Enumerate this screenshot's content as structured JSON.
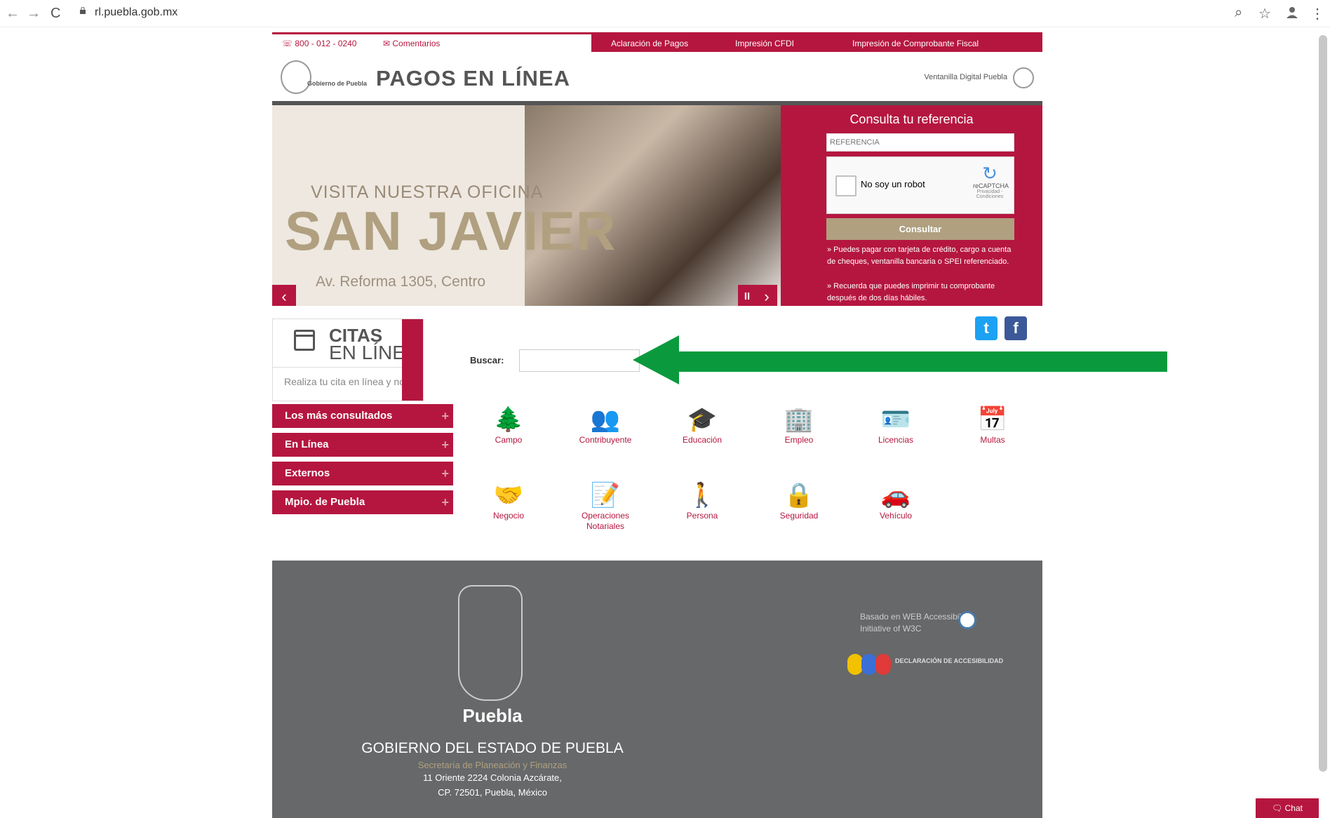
{
  "browser": {
    "url": "rl.puebla.gob.mx",
    "back_icon": "←",
    "forward_icon": "→",
    "reload_icon": "C",
    "zoom_icon": "⌕",
    "star_icon": "☆",
    "menu_icon": "⋮"
  },
  "topbar": {
    "phone": "800 - 012 - 0240",
    "comments": "Comentarios",
    "links": [
      "Aclaración de Pagos",
      "Impresión CFDI",
      "Impresión de Comprobante Fiscal"
    ]
  },
  "brand": {
    "gob_label": "Gobierno de Puebla",
    "title": "PAGOS EN LÍNEA",
    "right_label": "Ventanilla Digital Puebla"
  },
  "hero": {
    "kicker": "VISITA NUESTRA OFICINA",
    "headline": "SAN JAVIER",
    "address": "Av. Reforma 1305, Centro",
    "prev": "‹",
    "pause": "II",
    "next": "›"
  },
  "referencia": {
    "title": "Consulta tu referencia",
    "placeholder": "REFERENCIA",
    "captcha_label": "No soy un robot",
    "captcha_brand": "reCAPTCHA",
    "captcha_terms": "Privacidad - Condiciones",
    "button": "Consultar",
    "note1": "» Puedes pagar con tarjeta de crédito, cargo a cuenta de cheques, ventanilla bancaria o SPEI referenciado.",
    "note2": "» Recuerda que puedes imprimir tu comprobante después de dos días hábiles."
  },
  "citas": {
    "title1": "CITAS",
    "title2": "EN LÍNEA",
    "subtitle": "Realiza tu cita en línea y no hagas filas"
  },
  "menu": [
    {
      "label": "Los más consultados",
      "plus": "+"
    },
    {
      "label": "En Línea",
      "plus": "+"
    },
    {
      "label": "Externos",
      "plus": "+"
    },
    {
      "label": "Mpio. de Puebla",
      "plus": "+"
    }
  ],
  "search": {
    "label": "Buscar:"
  },
  "social": {
    "twitter": "t",
    "facebook": "f"
  },
  "categories": [
    {
      "label": "Campo",
      "icon": "🌲"
    },
    {
      "label": "Contribuyente",
      "icon": "👥"
    },
    {
      "label": "Educación",
      "icon": "🎓"
    },
    {
      "label": "Empleo",
      "icon": "🏢"
    },
    {
      "label": "Licencias",
      "icon": "🪪"
    },
    {
      "label": "Multas",
      "icon": "📅"
    },
    {
      "label": "Negocio",
      "icon": "🤝"
    },
    {
      "label": "Operaciones Notariales",
      "icon": "📝"
    },
    {
      "label": "Persona",
      "icon": "🚶"
    },
    {
      "label": "Seguridad",
      "icon": "🔒"
    },
    {
      "label": "Vehículo",
      "icon": "🚗"
    }
  ],
  "footer": {
    "puebla": "Puebla",
    "gov": "GOBIERNO DEL ESTADO DE PUEBLA",
    "sec": "Secretaría de Planeación y Finanzas",
    "addr1": "11 Oriente 2224 Colonia Azcárate,",
    "addr2": "CP. 72501, Puebla, México",
    "wai1": "Basado en  WEB Accessibility",
    "wai2": "Initiative of W3C",
    "decl": "DECLARACIÓN DE ACCESIBILIDAD"
  },
  "chat": {
    "label": "Chat"
  },
  "colors": {
    "brand": "#b5163f",
    "gold": "#b0a080",
    "footer": "#666869",
    "arrow": "#0a9a3d"
  }
}
